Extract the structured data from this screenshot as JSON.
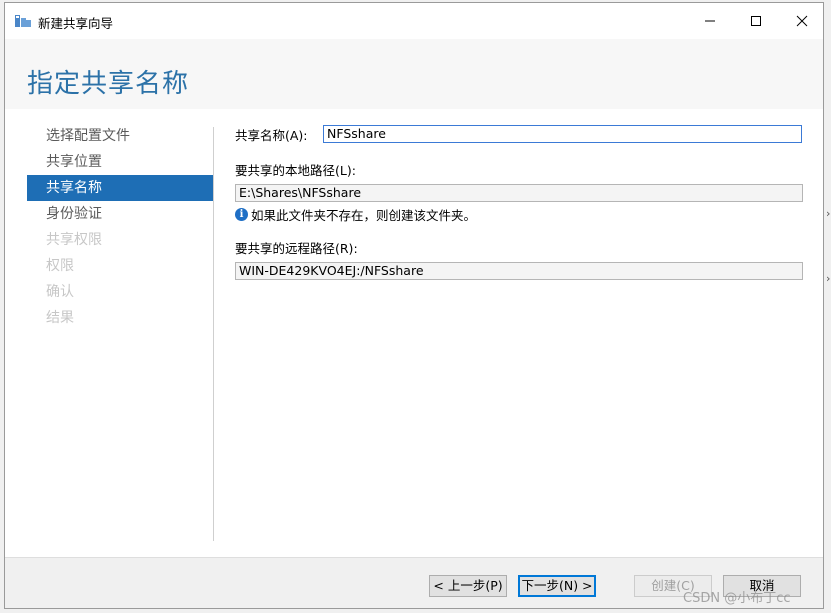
{
  "window": {
    "title": "新建共享向导",
    "minimize_glyph": "—",
    "maximize_glyph": "☐",
    "close_glyph": "✕"
  },
  "page_title": "指定共享名称",
  "nav": {
    "items": [
      {
        "label": "选择配置文件",
        "state": "normal"
      },
      {
        "label": "共享位置",
        "state": "normal"
      },
      {
        "label": "共享名称",
        "state": "selected"
      },
      {
        "label": "身份验证",
        "state": "normal"
      },
      {
        "label": "共享权限",
        "state": "disabled"
      },
      {
        "label": "权限",
        "state": "disabled"
      },
      {
        "label": "确认",
        "state": "disabled"
      },
      {
        "label": "结果",
        "state": "disabled"
      }
    ]
  },
  "form": {
    "share_name_label": "共享名称(A):",
    "share_name_value": "NFSshare",
    "local_path_label": "要共享的本地路径(L):",
    "local_path_value": "E:\\Shares\\NFSshare",
    "info_text": "如果此文件夹不存在，则创建该文件夹。",
    "remote_path_label": "要共享的远程路径(R):",
    "remote_path_value": "WIN-DE429KVO4EJ:/NFSshare"
  },
  "buttons": {
    "previous": "< 上一步(P)",
    "next": "下一步(N) >",
    "create": "创建(C)",
    "cancel": "取消"
  },
  "watermark": "CSDN @小布丁cc",
  "icons": {
    "app": "wizard-app-icon",
    "info": "info-icon"
  },
  "colors": {
    "title_accent": "#2c72a8",
    "nav_selected": "#1e6eb5",
    "info_icon": "#1f6fc5",
    "focus_border": "#3b7ad6"
  }
}
